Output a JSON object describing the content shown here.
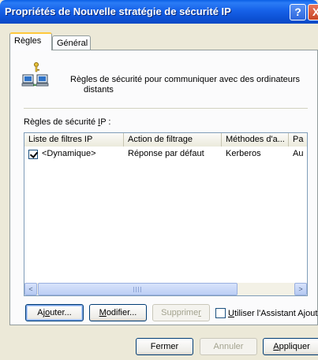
{
  "window": {
    "title": "Propriétés de Nouvelle stratégie de sécurité IP",
    "help_label": "?",
    "close_label": "X"
  },
  "tabs": [
    {
      "label": "Règles",
      "active": true
    },
    {
      "label": "Général",
      "active": false
    }
  ],
  "rules_section": {
    "icon": "network-computers-key-icon",
    "description_line1": "Règles de sécurité pour communiquer avec des ordinateurs",
    "description_line2": "distants",
    "list_label_pre": "Règles de sécurité ",
    "list_label_accel": "I",
    "list_label_post": "P :"
  },
  "rules_table": {
    "columns": [
      "Liste de filtres IP",
      "Action de filtrage",
      "Méthodes d'a...",
      "Pa"
    ],
    "rows": [
      {
        "checked": true,
        "filter_list": "<Dynamique>",
        "action": "Réponse par défaut",
        "methods": "Kerberos",
        "pa": "Au"
      }
    ]
  },
  "scrollbar": {
    "left_arrow": "<",
    "right_arrow": ">"
  },
  "buttons": {
    "add_pre": "Aj",
    "add_accel": "o",
    "add_post": "uter...",
    "modify_accel": "M",
    "modify_post": "odifier...",
    "delete_pre": "Supprime",
    "delete_accel": "r",
    "wizard_accel": "U",
    "wizard_post": "tiliser l'Assistant Ajout",
    "close": "Fermer",
    "cancel": "Annuler",
    "apply_accel": "A",
    "apply_post": "ppliquer"
  },
  "wizard_checked": false,
  "colors": {
    "titlebar": "#0b55dc",
    "dialog_bg": "#ece9d8",
    "tab_highlight": "#ffc83c",
    "button_border": "#003c74"
  }
}
